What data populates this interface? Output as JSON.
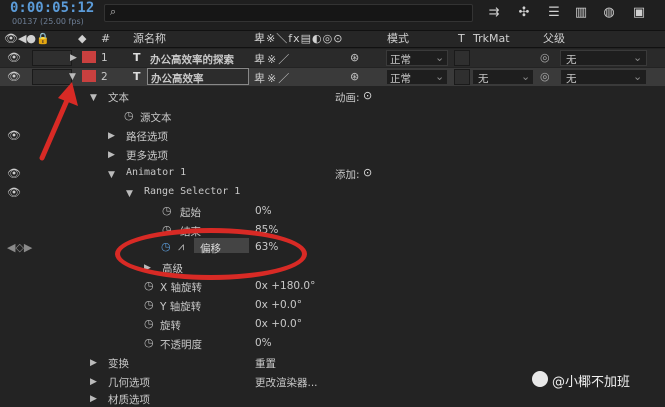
{
  "timecode": "0:00:05:12",
  "fps_info": "00137 (25.00 fps)",
  "search": {
    "placeholder": ""
  },
  "toolbar_icons": [
    "flowchart-icon",
    "puzzle-icon",
    "stack-icon",
    "graph-icon",
    "motion-blur-icon",
    "calendar-icon"
  ],
  "columns": {
    "num": "#",
    "source_name": "源名称",
    "mode": "模式",
    "t": "T",
    "trkmat": "TrkMat",
    "parent": "父级"
  },
  "layers": [
    {
      "num": "1",
      "type": "T",
      "name": "办公高效率的探索",
      "mode": "正常",
      "trkmat": "",
      "parent": "无"
    },
    {
      "num": "2",
      "type": "T",
      "name": "办公高效率",
      "mode": "正常",
      "trkmat": "无",
      "parent": "无"
    }
  ],
  "tree": {
    "text": "文本",
    "animate_label": "动画:",
    "source_text": "源文本",
    "path_options": "路径选项",
    "more_options": "更多选项",
    "animator": "Animator 1",
    "add_label": "添加:",
    "range_selector": "Range Selector 1",
    "start": {
      "label": "起始",
      "value": "0%"
    },
    "end": {
      "label": "结束",
      "value": "85%"
    },
    "offset": {
      "label": "偏移",
      "value": "63%"
    },
    "advanced": "高级",
    "x_rotation": {
      "label": "X 轴旋转",
      "value": "0x +180.0°"
    },
    "y_rotation": {
      "label": "Y 轴旋转",
      "value": "0x +0.0°"
    },
    "rotation": {
      "label": "旋转",
      "value": "0x +0.0°"
    },
    "opacity": {
      "label": "不透明度",
      "value": "0%"
    },
    "transform": {
      "label": "变换",
      "value": "重置"
    },
    "geometry": {
      "label": "几何选项",
      "value": "更改渲染器..."
    },
    "material": "材质选项"
  },
  "watermark": "@小椰不加班",
  "colors": {
    "accent": "#5b9bd8",
    "label_red": "#c9403f",
    "annotation": "#d82a25"
  }
}
